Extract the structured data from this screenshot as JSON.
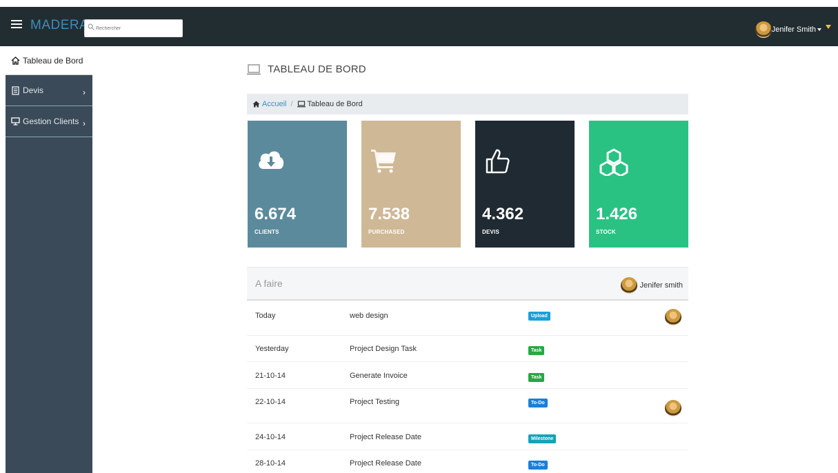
{
  "app": {
    "brand": "MADERA",
    "search_placeholder": "Rechercher",
    "user_name": "Jenifer Smith"
  },
  "sidebar": {
    "items": [
      {
        "label": "Tableau de Bord",
        "icon": "home-icon"
      },
      {
        "label": "Devis",
        "icon": "document-icon",
        "arrow": "›"
      },
      {
        "label": "Gestion Clients",
        "icon": "desktop-icon",
        "arrow": "›"
      }
    ]
  },
  "page": {
    "title": "TABLEAU DE BORD"
  },
  "breadcrumb": {
    "home": "Accueil",
    "separator": "/",
    "current": "Tableau de Bord"
  },
  "tiles": [
    {
      "value": "6.674",
      "label": "CLIENTS",
      "icon": "cloud-download-icon",
      "color": "#5b8a9c"
    },
    {
      "value": "7.538",
      "label": "PURCHASED",
      "icon": "cart-icon",
      "color": "#cfb896"
    },
    {
      "value": "4.362",
      "label": "DEVIS",
      "icon": "thumbs-up-icon",
      "color": "#1f2a33"
    },
    {
      "value": "1.426",
      "label": "STOCK",
      "icon": "cubes-icon",
      "color": "#2ac283"
    }
  ],
  "todo": {
    "title": "A faire",
    "user": "Jenifer smith",
    "rows": [
      {
        "date": "Today",
        "task": "web design",
        "badge": "Upload",
        "badge_color": "#1aa0d8",
        "avatar": true
      },
      {
        "date": "Yesterday",
        "task": "Project Design Task",
        "badge": "Task",
        "badge_color": "#28a745",
        "avatar": false
      },
      {
        "date": "21-10-14",
        "task": "Generate Invoice",
        "badge": "Task",
        "badge_color": "#28a745",
        "avatar": false
      },
      {
        "date": "22-10-14",
        "task": "Project Testing",
        "badge": "To-Do",
        "badge_color": "#1a7fd8",
        "avatar": true
      },
      {
        "date": "24-10-14",
        "task": "Project Release Date",
        "badge": "Milestone",
        "badge_color": "#17a2b8",
        "avatar": false
      },
      {
        "date": "28-10-14",
        "task": "Project Release Date",
        "badge": "To-Do",
        "badge_color": "#1a7fd8",
        "avatar": false
      }
    ]
  }
}
